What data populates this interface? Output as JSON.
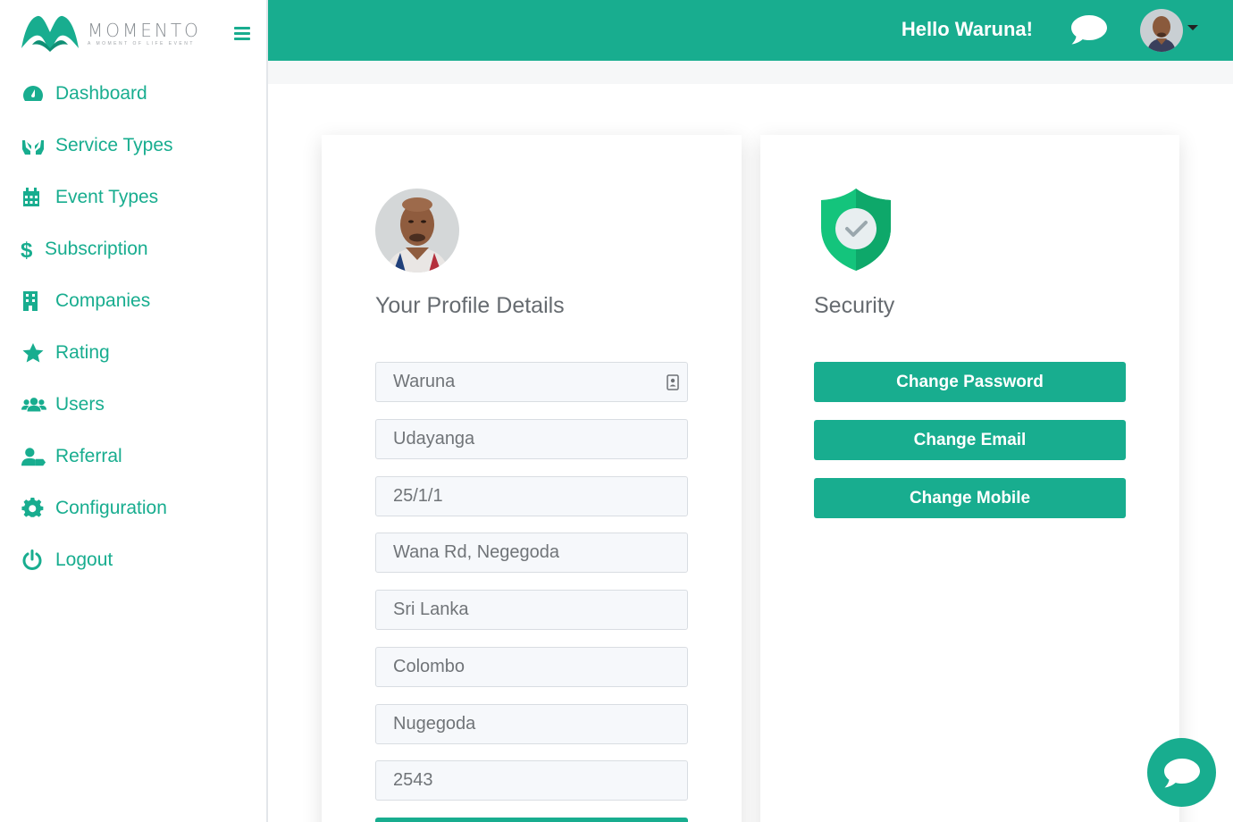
{
  "brand": {
    "name": "MOMENTO",
    "tagline": "A MOMENT OF LIFE EVENT",
    "accent_color": "#18ad8f"
  },
  "header": {
    "greeting": "Hello Waruna!",
    "chat_icon": "chat-bubble-icon",
    "avatar": "user-avatar"
  },
  "sidebar": {
    "items": [
      {
        "label": "Dashboard",
        "icon": "tachometer-icon"
      },
      {
        "label": "Service Types",
        "icon": "hands-icon"
      },
      {
        "label": "Event Types",
        "icon": "calendar-icon"
      },
      {
        "label": "Subscription",
        "icon": "dollar-icon"
      },
      {
        "label": "Companies",
        "icon": "building-icon"
      },
      {
        "label": "Rating",
        "icon": "star-icon"
      },
      {
        "label": "Users",
        "icon": "users-icon"
      },
      {
        "label": "Referral",
        "icon": "user-referral-icon"
      },
      {
        "label": "Configuration",
        "icon": "gear-icon"
      },
      {
        "label": "Logout",
        "icon": "power-icon"
      }
    ]
  },
  "profile": {
    "title": "Your Profile Details",
    "fields": [
      {
        "value": "Waruna"
      },
      {
        "value": "Udayanga"
      },
      {
        "value": "25/1/1"
      },
      {
        "value": "Wana Rd, Negegoda"
      },
      {
        "value": "Sri Lanka"
      },
      {
        "value": "Colombo"
      },
      {
        "value": "Nugegoda"
      },
      {
        "value": "2543"
      }
    ]
  },
  "security": {
    "title": "Security",
    "buttons": [
      {
        "label": "Change Password"
      },
      {
        "label": "Change Email"
      },
      {
        "label": "Change Mobile"
      }
    ]
  }
}
